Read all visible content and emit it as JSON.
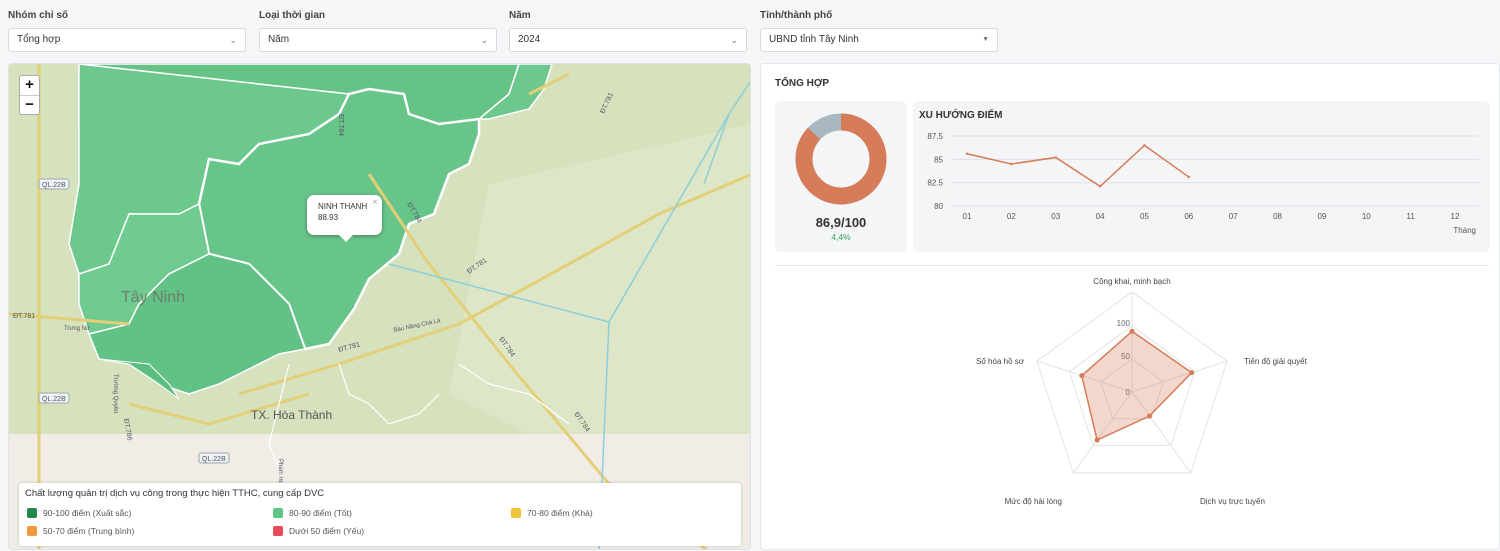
{
  "filters": [
    {
      "label": "Nhóm chỉ số",
      "value": "Tổng hợp"
    },
    {
      "label": "Loại thời gian",
      "value": "Năm"
    },
    {
      "label": "Năm",
      "value": "2024"
    },
    {
      "label": "Tỉnh/thành phố",
      "value": "UBND tỉnh Tây Ninh"
    }
  ],
  "map": {
    "zoom_in": "+",
    "zoom_out": "−",
    "place_labels": [
      "Tây Ninh",
      "TX. Hòa Thành"
    ],
    "road_labels": [
      "QL.22B",
      "QL.22B",
      "QL.22B",
      "ĐT.781",
      "ĐT.781",
      "ĐT.781",
      "ĐT.781",
      "ĐT.784",
      "ĐT.784",
      "ĐT.784",
      "ĐT.784",
      "ĐT.786",
      "Trưng Nữ",
      "Bàu Năng Chà Là",
      "Phạm Hùng",
      "Trường Quyền"
    ],
    "popup": {
      "name": "NINH THẠNH",
      "value": "88.93",
      "close": "×"
    },
    "legend": {
      "title": "Chất lượng quản trị dịch vụ công trong thực hiện TTHC, cung cấp DVC",
      "items": [
        {
          "label": "90-100 điểm (Xuất sắc)",
          "color": "#1e8a4c"
        },
        {
          "label": "80-90 điểm (Tốt)",
          "color": "#5cc487"
        },
        {
          "label": "70-80 điểm (Khá)",
          "color": "#f0c33c"
        },
        {
          "label": "50-70 điểm (Trung bình)",
          "color": "#f39a3d"
        },
        {
          "label": "Dưới 50 điểm (Yếu)",
          "color": "#e84c5a"
        }
      ]
    }
  },
  "summary": {
    "title": "TỔNG HỢP",
    "score": "86,9/100",
    "change": "4,4%",
    "score_fraction": 0.869,
    "colors": {
      "main": "#d67c58",
      "rest": "#a9b8c0"
    }
  },
  "trend": {
    "title": "XU HƯỚNG ĐIỂM",
    "x_unit": "Tháng"
  },
  "chart_data": [
    {
      "type": "line",
      "title": "XU HƯỚNG ĐIỂM",
      "xlabel": "Tháng",
      "categories": [
        "01",
        "02",
        "03",
        "04",
        "05",
        "06",
        "07",
        "08",
        "09",
        "10",
        "11",
        "12"
      ],
      "values": [
        85.6,
        84.5,
        85.2,
        82.1,
        86.5,
        83.1,
        null,
        null,
        null,
        null,
        null,
        null
      ],
      "yticks": [
        "80",
        "82.5",
        "85",
        "87.5"
      ],
      "ylim": [
        80,
        87.5
      ],
      "color": "#d67c58"
    },
    {
      "type": "radar",
      "axes": [
        "Công khai, minh bạch",
        "Tiến độ giải quyết",
        "Dịch vụ trực tuyến",
        "Mức độ hài lòng",
        "Số hóa hồ sơ"
      ],
      "values": [
        92,
        95,
        45,
        90,
        80
      ],
      "rticks": [
        "0",
        "50",
        "100"
      ],
      "rmax": 100,
      "color": "#d67c58"
    }
  ]
}
